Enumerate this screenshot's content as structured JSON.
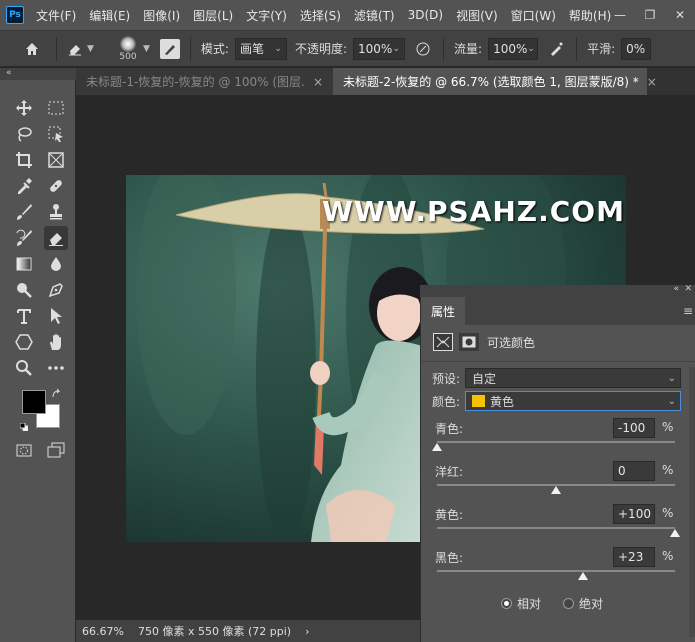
{
  "app": {
    "logo": "Ps"
  },
  "menu": [
    "文件(F)",
    "编辑(E)",
    "图像(I)",
    "图层(L)",
    "文字(Y)",
    "选择(S)",
    "滤镜(T)",
    "3D(D)",
    "视图(V)",
    "窗口(W)",
    "帮助(H)"
  ],
  "window_controls": {
    "minimize": "—",
    "restore": "❐",
    "close": "✕"
  },
  "options": {
    "brush_size": "500",
    "mode_label": "模式:",
    "mode_value": "画笔",
    "opacity_label": "不透明度:",
    "opacity_value": "100%",
    "flow_label": "流量:",
    "flow_value": "100%",
    "smooth_label": "平滑:",
    "smooth_value": "0%"
  },
  "tabs": [
    {
      "label": "未标题-1-恢复的-恢复的 @ 100% (图层...",
      "close": "×"
    },
    {
      "label": "未标题-2-恢复的 @ 66.7% (选取颜色 1, 图层蒙版/8) *",
      "close": "×"
    }
  ],
  "collapse": "«",
  "image_watermark": "WWW.PSAHZ.COM",
  "status": {
    "zoom": "66.67%",
    "doc_info": "750 像素 x 550 像素 (72 ppi)",
    "arrow": "›"
  },
  "panel": {
    "collapse": "«",
    "close": "✕",
    "tab_label": "属性",
    "menu_icon": "≡",
    "title": "可选颜色",
    "preset_label": "预设:",
    "preset_value": "自定",
    "color_label": "颜色:",
    "color_value": "黄色",
    "color_swatch": "#f5c400",
    "sliders": [
      {
        "label": "青色:",
        "value": "-100",
        "unit": "%",
        "level": -100
      },
      {
        "label": "洋红:",
        "value": "0",
        "unit": "%",
        "level": 0
      },
      {
        "label": "黄色:",
        "value": "+100",
        "unit": "%",
        "level": 100
      },
      {
        "label": "黑色:",
        "value": "+23",
        "unit": "%",
        "level": 23
      }
    ],
    "method_relative": "相对",
    "method_absolute": "绝对",
    "method_selected": "relative"
  },
  "colors": {
    "foreground": "#000000",
    "background": "#ffffff"
  }
}
